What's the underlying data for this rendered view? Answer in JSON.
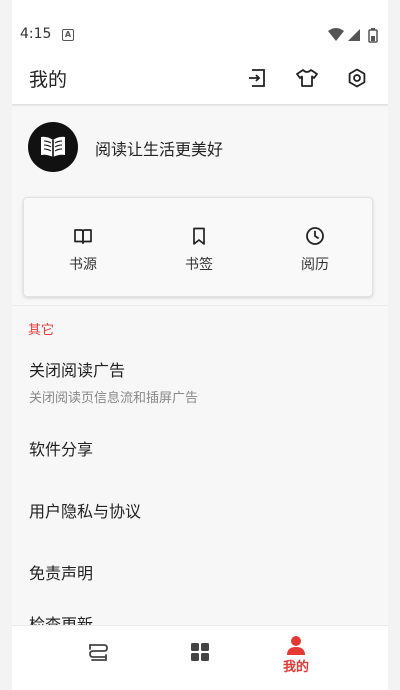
{
  "status_bar": {
    "time": "4:15",
    "notification_badge": "A"
  },
  "app_bar": {
    "title": "我的",
    "actions": [
      {
        "name": "import-icon"
      },
      {
        "name": "theme-shirt-icon"
      },
      {
        "name": "settings-icon"
      }
    ]
  },
  "profile": {
    "motto": "阅读让生活更美好"
  },
  "shortcuts": [
    {
      "label": "书源",
      "icon": "book-open-icon"
    },
    {
      "label": "书签",
      "icon": "bookmark-icon"
    },
    {
      "label": "阅历",
      "icon": "clock-icon"
    }
  ],
  "section": {
    "title": "其它"
  },
  "settings": [
    {
      "title": "关闭阅读广告",
      "subtitle": "关闭阅读页信息流和插屏广告"
    },
    {
      "title": "软件分享"
    },
    {
      "title": "用户隐私与协议"
    },
    {
      "title": "免责声明"
    },
    {
      "title": "检查更新"
    }
  ],
  "bottom_nav": [
    {
      "icon": "bookshelf-icon",
      "active": false
    },
    {
      "icon": "grid-icon",
      "active": false
    },
    {
      "icon": "person-icon",
      "label": "我的",
      "active": true
    }
  ],
  "colors": {
    "accent": "#e53935",
    "background": "#f7f7f7",
    "text": "#222222"
  }
}
